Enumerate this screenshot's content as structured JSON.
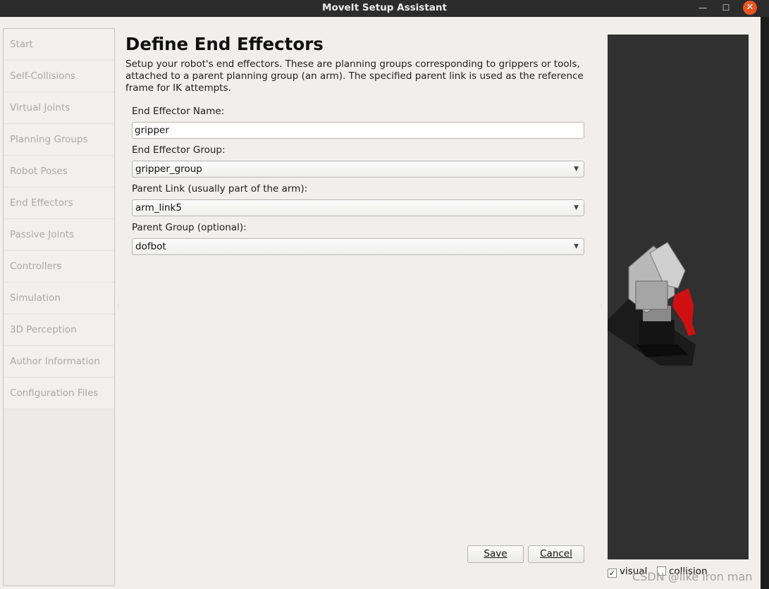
{
  "window": {
    "title": "MoveIt Setup Assistant",
    "minimize_glyph": "—",
    "maximize_glyph": "☐",
    "close_glyph": "✕"
  },
  "nav": {
    "items": [
      {
        "label": "Start"
      },
      {
        "label": "Self-Collisions"
      },
      {
        "label": "Virtual Joints"
      },
      {
        "label": "Planning Groups"
      },
      {
        "label": "Robot Poses"
      },
      {
        "label": "End Effectors"
      },
      {
        "label": "Passive Joints"
      },
      {
        "label": "Controllers"
      },
      {
        "label": "Simulation"
      },
      {
        "label": "3D Perception"
      },
      {
        "label": "Author Information"
      },
      {
        "label": "Configuration Files"
      }
    ]
  },
  "main": {
    "title": "Define End Effectors",
    "description": "Setup your robot's end effectors. These are planning groups corresponding to grippers or tools, attached to a parent planning group (an arm). The specified parent link is used as the reference frame for IK attempts.",
    "fields": {
      "name_label": "End Effector Name:",
      "name_value": "gripper",
      "group_label": "End Effector Group:",
      "group_value": "gripper_group",
      "parent_link_label": "Parent Link (usually part of the arm):",
      "parent_link_value": "arm_link5",
      "parent_group_label": "Parent Group (optional):",
      "parent_group_value": "dofbot"
    },
    "save_label": "Save",
    "cancel_label": "Cancel"
  },
  "viewport": {
    "visual_label": "visual",
    "visual_checked": true,
    "visual_check_glyph": "✓",
    "collision_label": "collision",
    "collision_checked": false,
    "background_color": "#303030",
    "gripper_color": "#d01010"
  },
  "watermark": "CSDN @like iron man",
  "colors": {
    "titlebar": "#2c2c2c",
    "close_button": "#e95420",
    "disabled_nav_text": "#a9a9a9"
  }
}
